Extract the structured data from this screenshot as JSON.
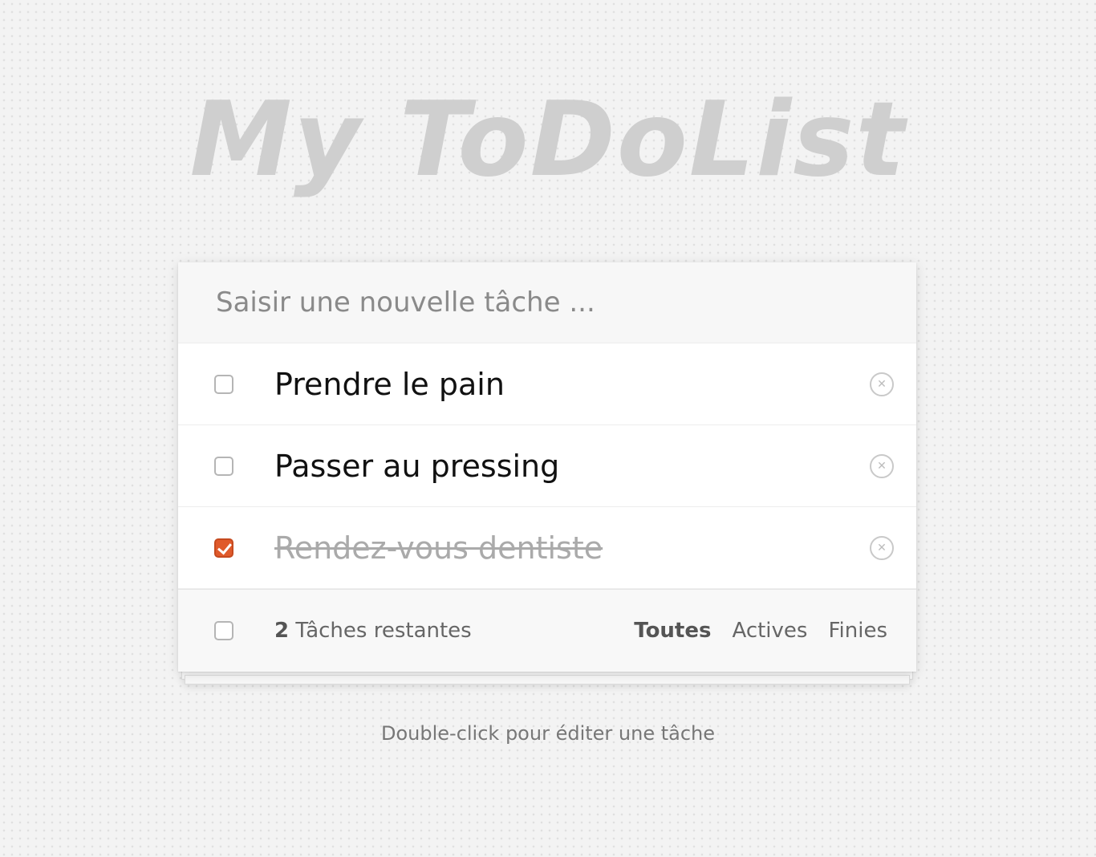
{
  "app": {
    "title": "My ToDoList"
  },
  "new_todo": {
    "placeholder": "Saisir une nouvelle tâche ...",
    "value": ""
  },
  "todos": [
    {
      "label": "Prendre le pain",
      "completed": false
    },
    {
      "label": "Passer au pressing",
      "completed": false
    },
    {
      "label": "Rendez-vous dentiste",
      "completed": true
    }
  ],
  "footer": {
    "remaining_count": "2",
    "remaining_label": "Tâches restantes",
    "filters": [
      {
        "label": "Toutes",
        "selected": true
      },
      {
        "label": "Actives",
        "selected": false
      },
      {
        "label": "Finies",
        "selected": false
      }
    ]
  },
  "hint": "Double-click pour éditer une tâche",
  "colors": {
    "accent": "#e05a2b",
    "title": "#cfcfcf",
    "background": "#f3f3f3"
  },
  "icons": {
    "destroy": "close-circle-icon",
    "checkbox_checked": "check-icon"
  }
}
